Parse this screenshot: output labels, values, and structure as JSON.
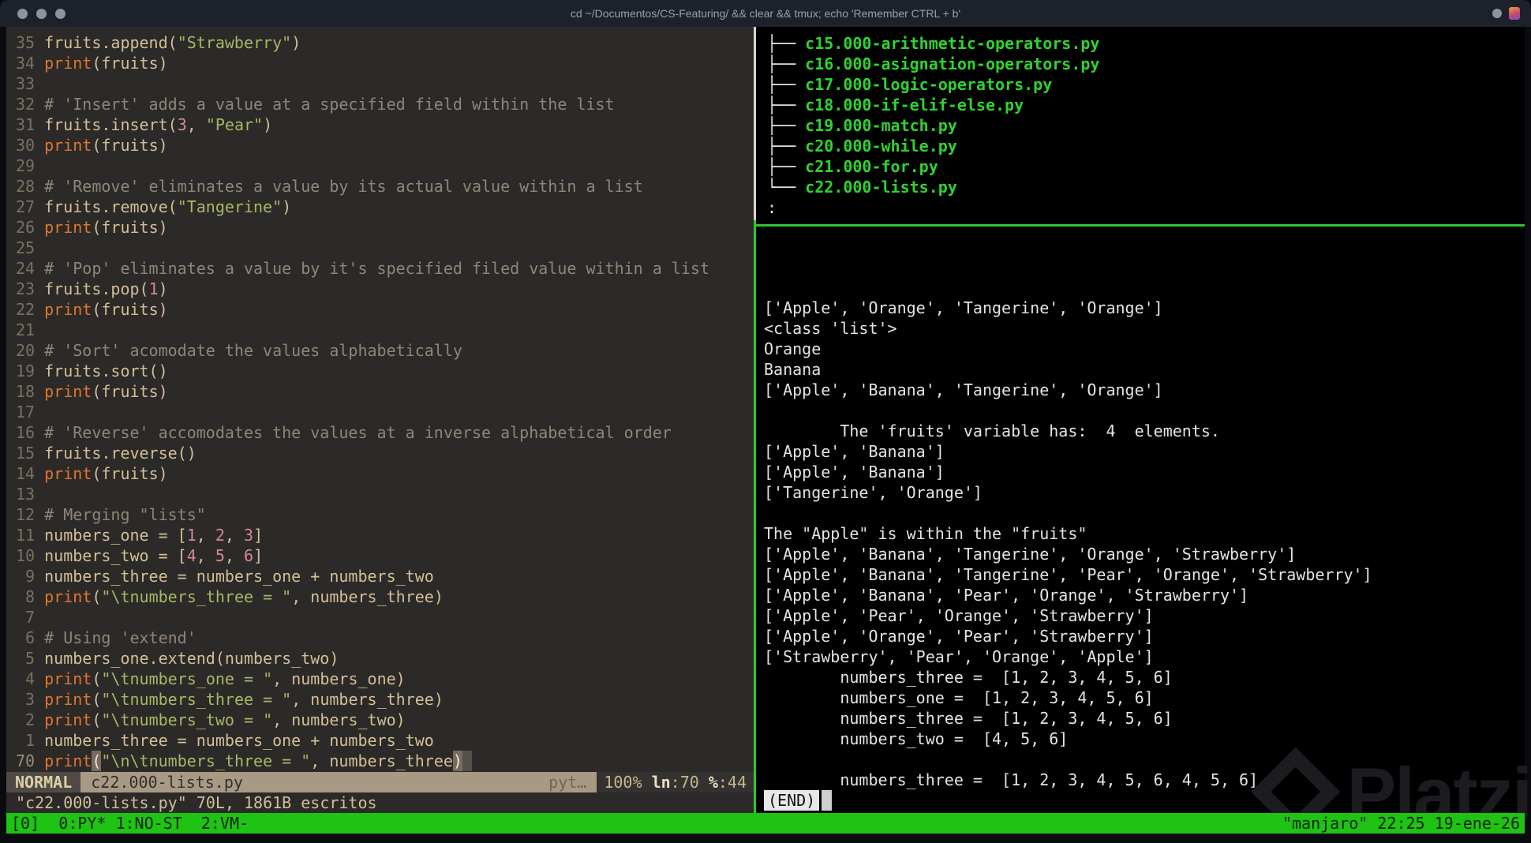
{
  "titlebar": {
    "title": "cd ~/Documentos/CS-Featuring/ && clear && tmux; echo 'Remember CTRL + b'"
  },
  "editor": {
    "lines": [
      {
        "num": "35",
        "segs": [
          [
            "n",
            "fruits.append("
          ],
          [
            "s",
            "\"Strawberry\""
          ],
          [
            "n",
            ")"
          ]
        ]
      },
      {
        "num": "34",
        "segs": [
          [
            "f",
            "print"
          ],
          [
            "n",
            "(fruits)"
          ]
        ]
      },
      {
        "num": "33",
        "segs": []
      },
      {
        "num": "32",
        "segs": [
          [
            "c",
            "# 'Insert' adds a value at a specified field within the list"
          ]
        ]
      },
      {
        "num": "31",
        "segs": [
          [
            "n",
            "fruits.insert("
          ],
          [
            "d",
            "3"
          ],
          [
            "n",
            ", "
          ],
          [
            "s",
            "\"Pear\""
          ],
          [
            "n",
            ")"
          ]
        ]
      },
      {
        "num": "30",
        "segs": [
          [
            "f",
            "print"
          ],
          [
            "n",
            "(fruits)"
          ]
        ]
      },
      {
        "num": "29",
        "segs": []
      },
      {
        "num": "28",
        "segs": [
          [
            "c",
            "# 'Remove' eliminates a value by its actual value within a list"
          ]
        ]
      },
      {
        "num": "27",
        "segs": [
          [
            "n",
            "fruits.remove("
          ],
          [
            "s",
            "\"Tangerine\""
          ],
          [
            "n",
            ")"
          ]
        ]
      },
      {
        "num": "26",
        "segs": [
          [
            "f",
            "print"
          ],
          [
            "n",
            "(fruits)"
          ]
        ]
      },
      {
        "num": "25",
        "segs": []
      },
      {
        "num": "24",
        "segs": [
          [
            "c",
            "# 'Pop' eliminates a value by it's specified filed value within a list"
          ]
        ]
      },
      {
        "num": "23",
        "segs": [
          [
            "n",
            "fruits.pop("
          ],
          [
            "d",
            "1"
          ],
          [
            "n",
            ")"
          ]
        ]
      },
      {
        "num": "22",
        "segs": [
          [
            "f",
            "print"
          ],
          [
            "n",
            "(fruits)"
          ]
        ]
      },
      {
        "num": "21",
        "segs": []
      },
      {
        "num": "20",
        "segs": [
          [
            "c",
            "# 'Sort' acomodate the values alphabetically"
          ]
        ]
      },
      {
        "num": "19",
        "segs": [
          [
            "n",
            "fruits.sort()"
          ]
        ]
      },
      {
        "num": "18",
        "segs": [
          [
            "f",
            "print"
          ],
          [
            "n",
            "(fruits)"
          ]
        ]
      },
      {
        "num": "17",
        "segs": []
      },
      {
        "num": "16",
        "segs": [
          [
            "c",
            "# 'Reverse' accomodates the values at a inverse alphabetical order"
          ]
        ]
      },
      {
        "num": "15",
        "segs": [
          [
            "n",
            "fruits.reverse()"
          ]
        ]
      },
      {
        "num": "14",
        "segs": [
          [
            "f",
            "print"
          ],
          [
            "n",
            "(fruits)"
          ]
        ]
      },
      {
        "num": "13",
        "segs": []
      },
      {
        "num": "12",
        "segs": [
          [
            "c",
            "# Merging \"lists\""
          ]
        ]
      },
      {
        "num": "11",
        "segs": [
          [
            "n",
            "numbers_one = ["
          ],
          [
            "d",
            "1"
          ],
          [
            "n",
            ", "
          ],
          [
            "d",
            "2"
          ],
          [
            "n",
            ", "
          ],
          [
            "d",
            "3"
          ],
          [
            "n",
            "]"
          ]
        ]
      },
      {
        "num": "10",
        "segs": [
          [
            "n",
            "numbers_two = ["
          ],
          [
            "d",
            "4"
          ],
          [
            "n",
            ", "
          ],
          [
            "d",
            "5"
          ],
          [
            "n",
            ", "
          ],
          [
            "d",
            "6"
          ],
          [
            "n",
            "]"
          ]
        ]
      },
      {
        "num": " 9",
        "segs": [
          [
            "n",
            "numbers_three = numbers_one + numbers_two"
          ]
        ]
      },
      {
        "num": " 8",
        "segs": [
          [
            "f",
            "print"
          ],
          [
            "n",
            "("
          ],
          [
            "s",
            "\"\\tnumbers_three = \""
          ],
          [
            "n",
            ", numbers_three)"
          ]
        ]
      },
      {
        "num": " 7",
        "segs": []
      },
      {
        "num": " 6",
        "segs": [
          [
            "c",
            "# Using 'extend'"
          ]
        ]
      },
      {
        "num": " 5",
        "segs": [
          [
            "n",
            "numbers_one.extend(numbers_two)"
          ]
        ]
      },
      {
        "num": " 4",
        "segs": [
          [
            "f",
            "print"
          ],
          [
            "n",
            "("
          ],
          [
            "s",
            "\"\\tnumbers_one = \""
          ],
          [
            "n",
            ", numbers_one)"
          ]
        ]
      },
      {
        "num": " 3",
        "segs": [
          [
            "f",
            "print"
          ],
          [
            "n",
            "("
          ],
          [
            "s",
            "\"\\tnumbers_three = \""
          ],
          [
            "n",
            ", numbers_three)"
          ]
        ]
      },
      {
        "num": " 2",
        "segs": [
          [
            "f",
            "print"
          ],
          [
            "n",
            "("
          ],
          [
            "s",
            "\"\\tnumbers_two = \""
          ],
          [
            "n",
            ", numbers_two)"
          ]
        ]
      },
      {
        "num": " 1",
        "segs": [
          [
            "n",
            "numbers_three = numbers_one + numbers_two"
          ]
        ]
      },
      {
        "num": "70",
        "cur": true,
        "segs": [
          [
            "f",
            "print"
          ],
          [
            "mp",
            "("
          ],
          [
            "s",
            "\"\\n\\tnumbers_three = \""
          ],
          [
            "n",
            ", numbers_three"
          ],
          [
            "mp",
            ")"
          ],
          [
            "cur",
            " "
          ]
        ]
      }
    ]
  },
  "statusline": {
    "mode": "NORMAL",
    "filename": "c22.000-lists.py",
    "filetype": "pyt…",
    "percent": "100% ",
    "ln_label": "ln",
    "ln_value": ":70 ",
    "col_label": "%",
    "col_value": ":44"
  },
  "message": "\"c22.000-lists.py\" 70L, 1861B escritos",
  "tree": {
    "items": [
      {
        "branch": "├── ",
        "name": "c15.000-arithmetic-operators.py"
      },
      {
        "branch": "├── ",
        "name": "c16.000-asignation-operators.py"
      },
      {
        "branch": "├── ",
        "name": "c17.000-logic-operators.py"
      },
      {
        "branch": "├── ",
        "name": "c18.000-if-elif-else.py"
      },
      {
        "branch": "├── ",
        "name": "c19.000-match.py"
      },
      {
        "branch": "├── ",
        "name": "c20.000-while.py"
      },
      {
        "branch": "├── ",
        "name": "c21.000-for.py"
      },
      {
        "branch": "└── ",
        "name": "c22.000-lists.py"
      }
    ],
    "prompt": ":"
  },
  "output": {
    "lines": [
      "",
      "",
      "",
      "['Apple', 'Orange', 'Tangerine', 'Orange']",
      "<class 'list'>",
      "Orange",
      "Banana",
      "['Apple', 'Banana', 'Tangerine', 'Orange']",
      "",
      "        The 'fruits' variable has:  4  elements.",
      "['Apple', 'Banana']",
      "['Apple', 'Banana']",
      "['Tangerine', 'Orange']",
      "",
      "The \"Apple\" is within the \"fruits\"",
      "['Apple', 'Banana', 'Tangerine', 'Orange', 'Strawberry']",
      "['Apple', 'Banana', 'Tangerine', 'Pear', 'Orange', 'Strawberry']",
      "['Apple', 'Banana', 'Pear', 'Orange', 'Strawberry']",
      "['Apple', 'Pear', 'Orange', 'Strawberry']",
      "['Apple', 'Orange', 'Pear', 'Strawberry']",
      "['Strawberry', 'Pear', 'Orange', 'Apple']",
      "        numbers_three =  [1, 2, 3, 4, 5, 6]",
      "        numbers_one =  [1, 2, 3, 4, 5, 6]",
      "        numbers_three =  [1, 2, 3, 4, 5, 6]",
      "        numbers_two =  [4, 5, 6]",
      "",
      "        numbers_three =  [1, 2, 3, 4, 5, 6, 4, 5, 6]"
    ],
    "end_label": "(END)"
  },
  "tmux": {
    "left": "[0]  0:PY* 1:NO-ST  2:VM-",
    "right": "\"manjaro\" 22:25 19-ene-26"
  },
  "watermark": {
    "text": "Platzi"
  },
  "colors": {
    "accent_green": "#1fc313",
    "pane_border_active": "#2fc42f",
    "pane_border_inactive": "#d8d4c8",
    "editor_bg": "#2c2a28",
    "terminal_bg": "#000000",
    "string": "#a9b665",
    "function": "#e2742f",
    "number": "#d3869b",
    "comment": "#8f8578",
    "foreground": "#d4be98",
    "tree_file": "#2fd32f"
  }
}
